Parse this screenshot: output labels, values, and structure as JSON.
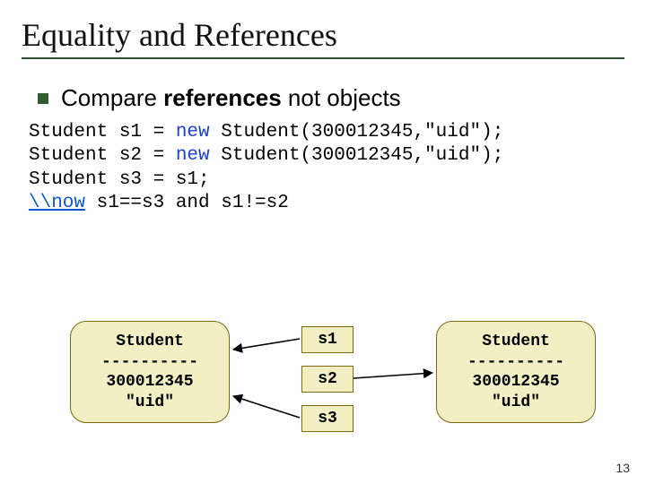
{
  "title": "Equality and References",
  "bullet": {
    "prefix": "Compare ",
    "strong": "references",
    "suffix": " not objects"
  },
  "code": {
    "l1a": "Student s1 = ",
    "l1b": "new",
    "l1c": " Student(300012345,\"uid\");",
    "l2a": "Student s2 = ",
    "l2b": "new",
    "l2c": " Student(300012345,\"uid\");",
    "l3": "Student s3 = s1;",
    "l4a": "\\\\now",
    "l4b": " s1==s3 and s1!=s2"
  },
  "obj": {
    "l1": "Student",
    "l2": "----------",
    "l3": "300012345",
    "l4": "\"uid\""
  },
  "refs": {
    "s1": "s1",
    "s2": "s2",
    "s3": "s3"
  },
  "pagenum": "13"
}
